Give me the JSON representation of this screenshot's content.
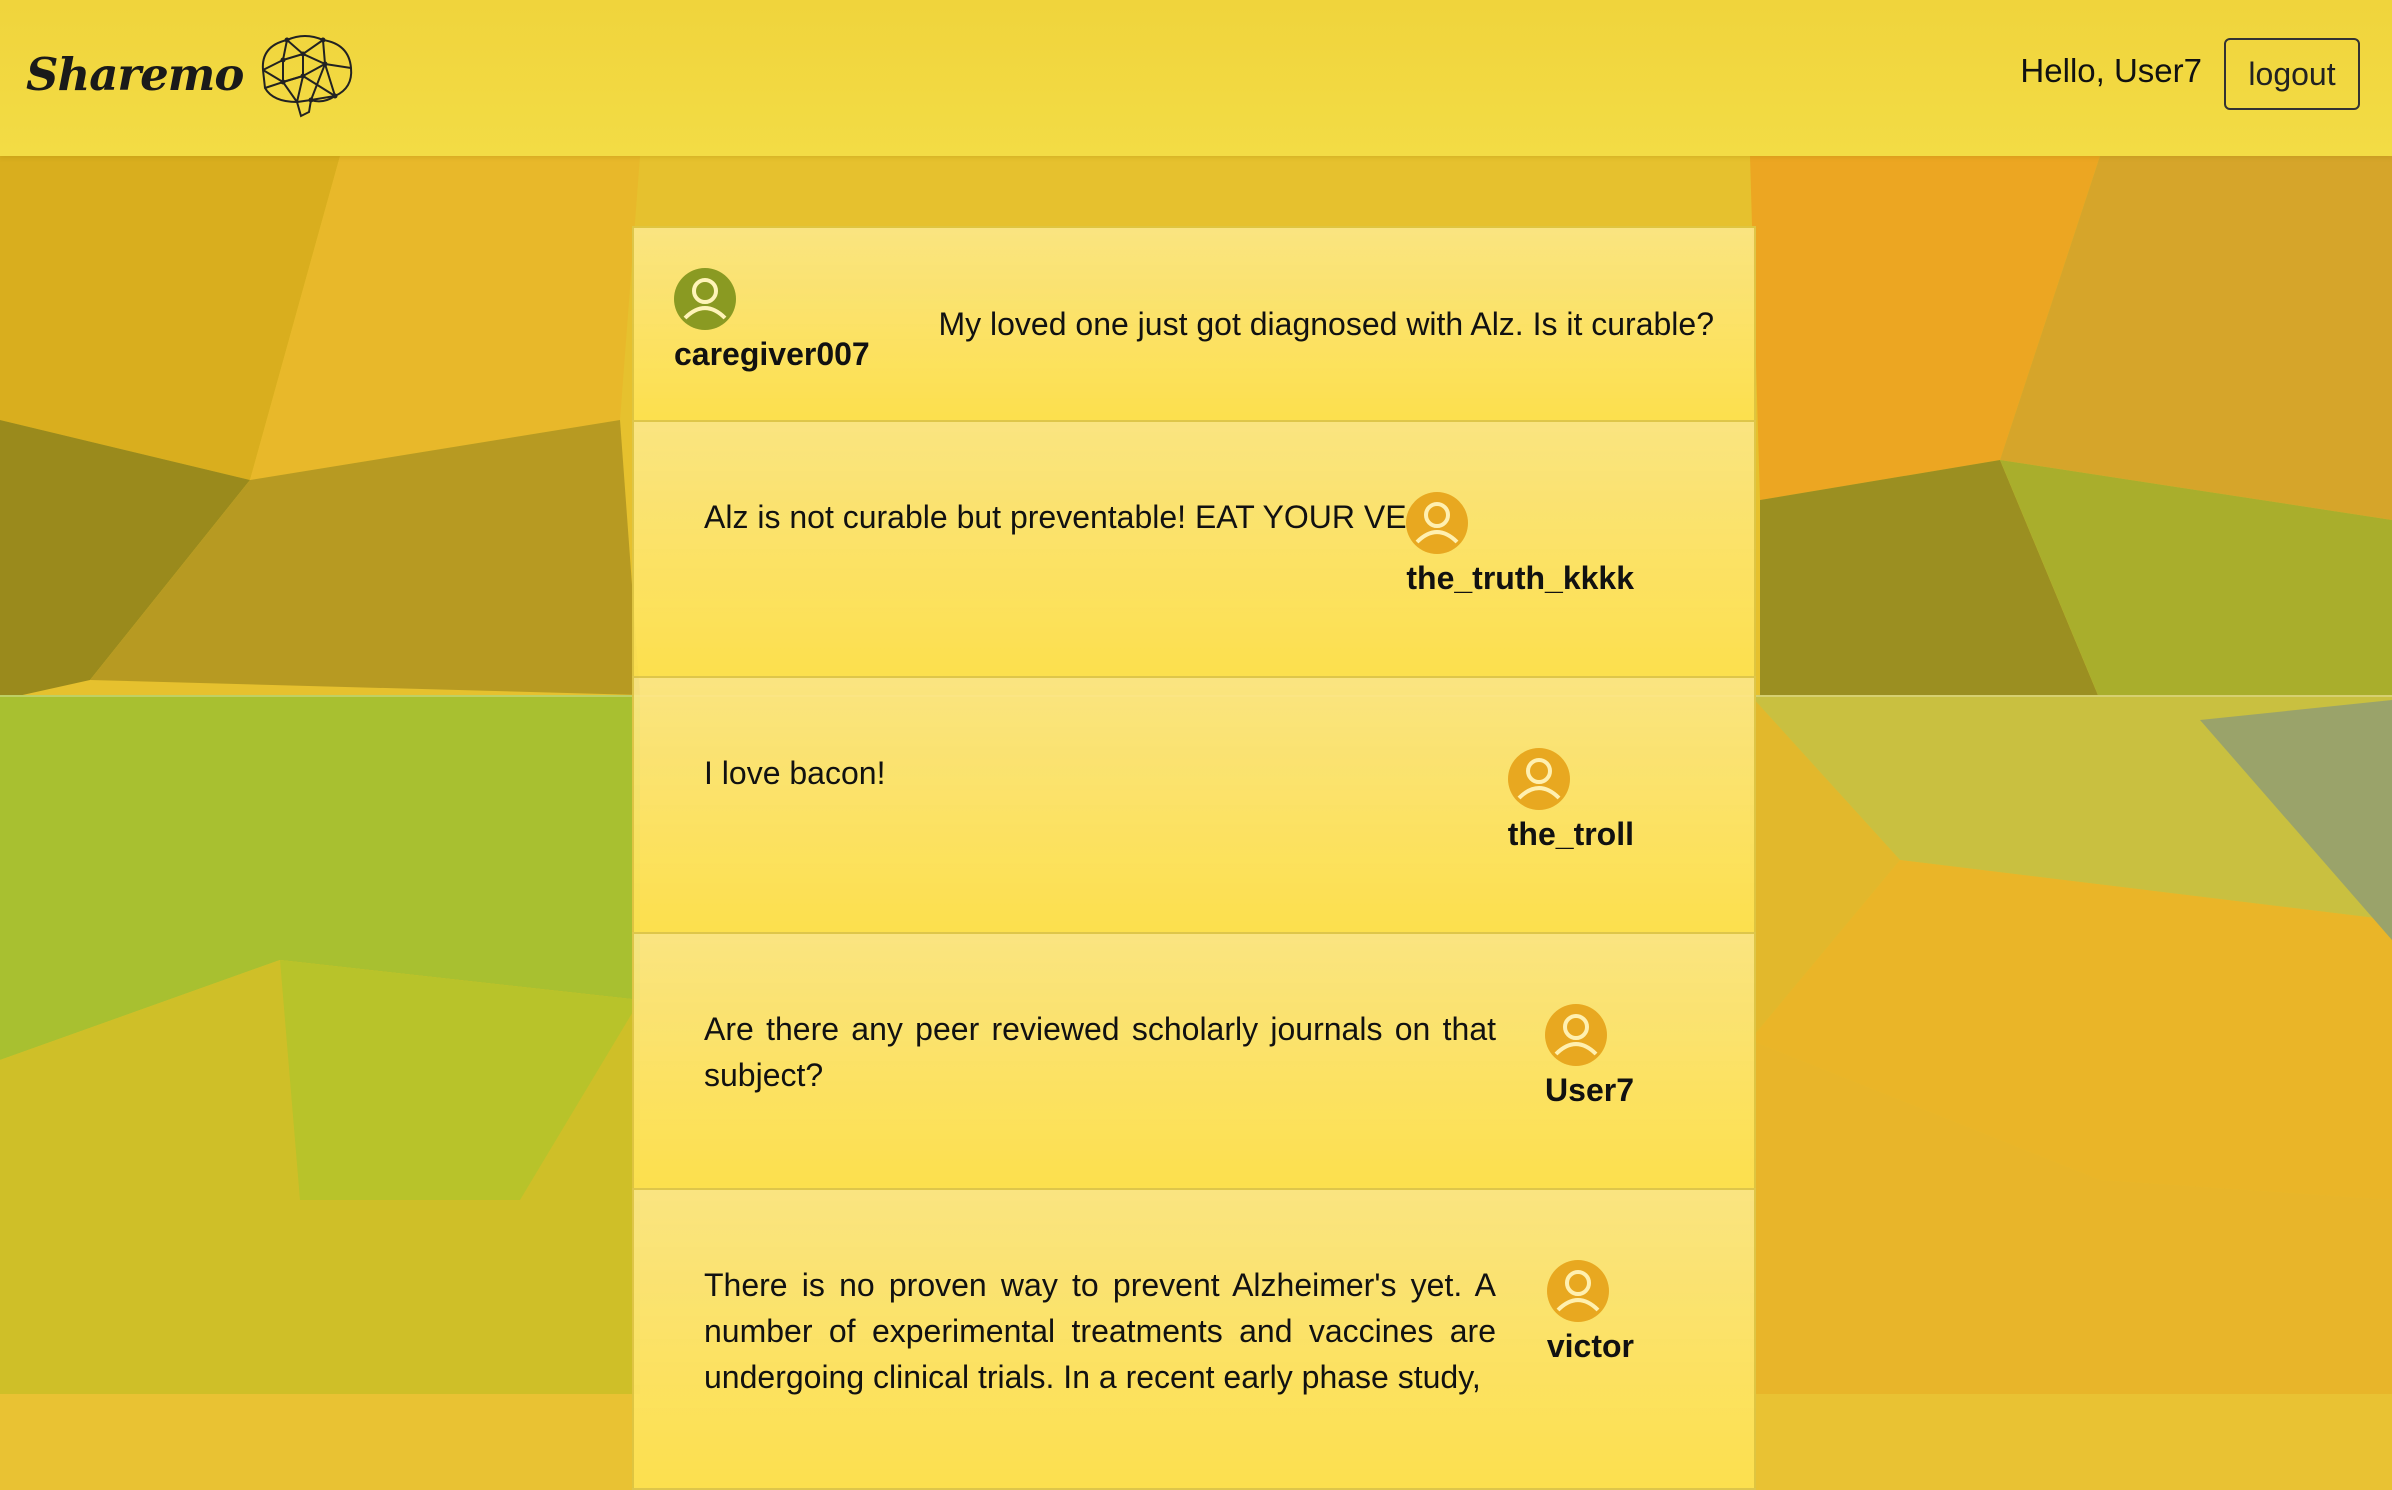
{
  "app": {
    "brand": "Sharemo",
    "greeting": "Hello, User7",
    "logout_label": "logout"
  },
  "colors": {
    "topbar": "#f0d43c",
    "avatar_question": "#8a9a22",
    "avatar_reply": "#e8a820",
    "card": "#fde46a"
  },
  "question": {
    "author": "caregiver007",
    "avatar_icon": "user-avatar-icon",
    "text": "My loved one just got diagnosed with Alz. Is it curable?"
  },
  "replies": [
    {
      "author": "the_truth_kkkk",
      "text": "Alz is not curable but preventable! EAT YOUR VEGS!"
    },
    {
      "author": "the_troll",
      "text": "I love bacon!"
    },
    {
      "author": "User7",
      "text": "Are there any peer reviewed scholarly journals on that subject?"
    },
    {
      "author": "victor",
      "text": "There is no proven way to prevent Alzheimer's yet. A number of experimental treatments and vaccines are undergoing clinical trials. In a recent early phase study,"
    }
  ]
}
